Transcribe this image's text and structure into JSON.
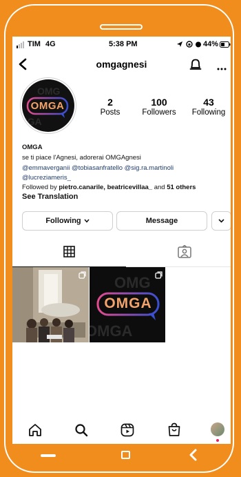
{
  "status": {
    "carrier": "TIM",
    "network": "4G",
    "time": "5:38 PM",
    "battery": "44%"
  },
  "header": {
    "username": "omgagnesi"
  },
  "profile": {
    "avatar_text": "OMGA",
    "stats": [
      {
        "count": "2",
        "label": "Posts"
      },
      {
        "count": "100",
        "label": "Followers"
      },
      {
        "count": "43",
        "label": "Following"
      }
    ],
    "name": "OMGA",
    "bio": "se ti piace l'Agnesi, adorerai OMGAgnesi",
    "mentions_line1": "@emmaverganii @tobiasanfratello @sig.ra.martinoli",
    "mentions_line2": "@lucreziameris_",
    "followed_by_prefix": "Followed by ",
    "followed_by_names": "pietro.canarile, beatricevillaa_",
    "followed_by_and": " and ",
    "followed_by_others": "51 others",
    "see_translation": "See Translation"
  },
  "actions": {
    "following": "Following",
    "message": "Message"
  },
  "posts": [
    {
      "alt": "photo of people at a table"
    },
    {
      "logo_text": "OMGA"
    }
  ],
  "colors": {
    "frame": "#f08d1c",
    "link": "#1f3b6b",
    "logo_pink": "#e24c8e",
    "logo_blue": "#3a4fd0"
  }
}
